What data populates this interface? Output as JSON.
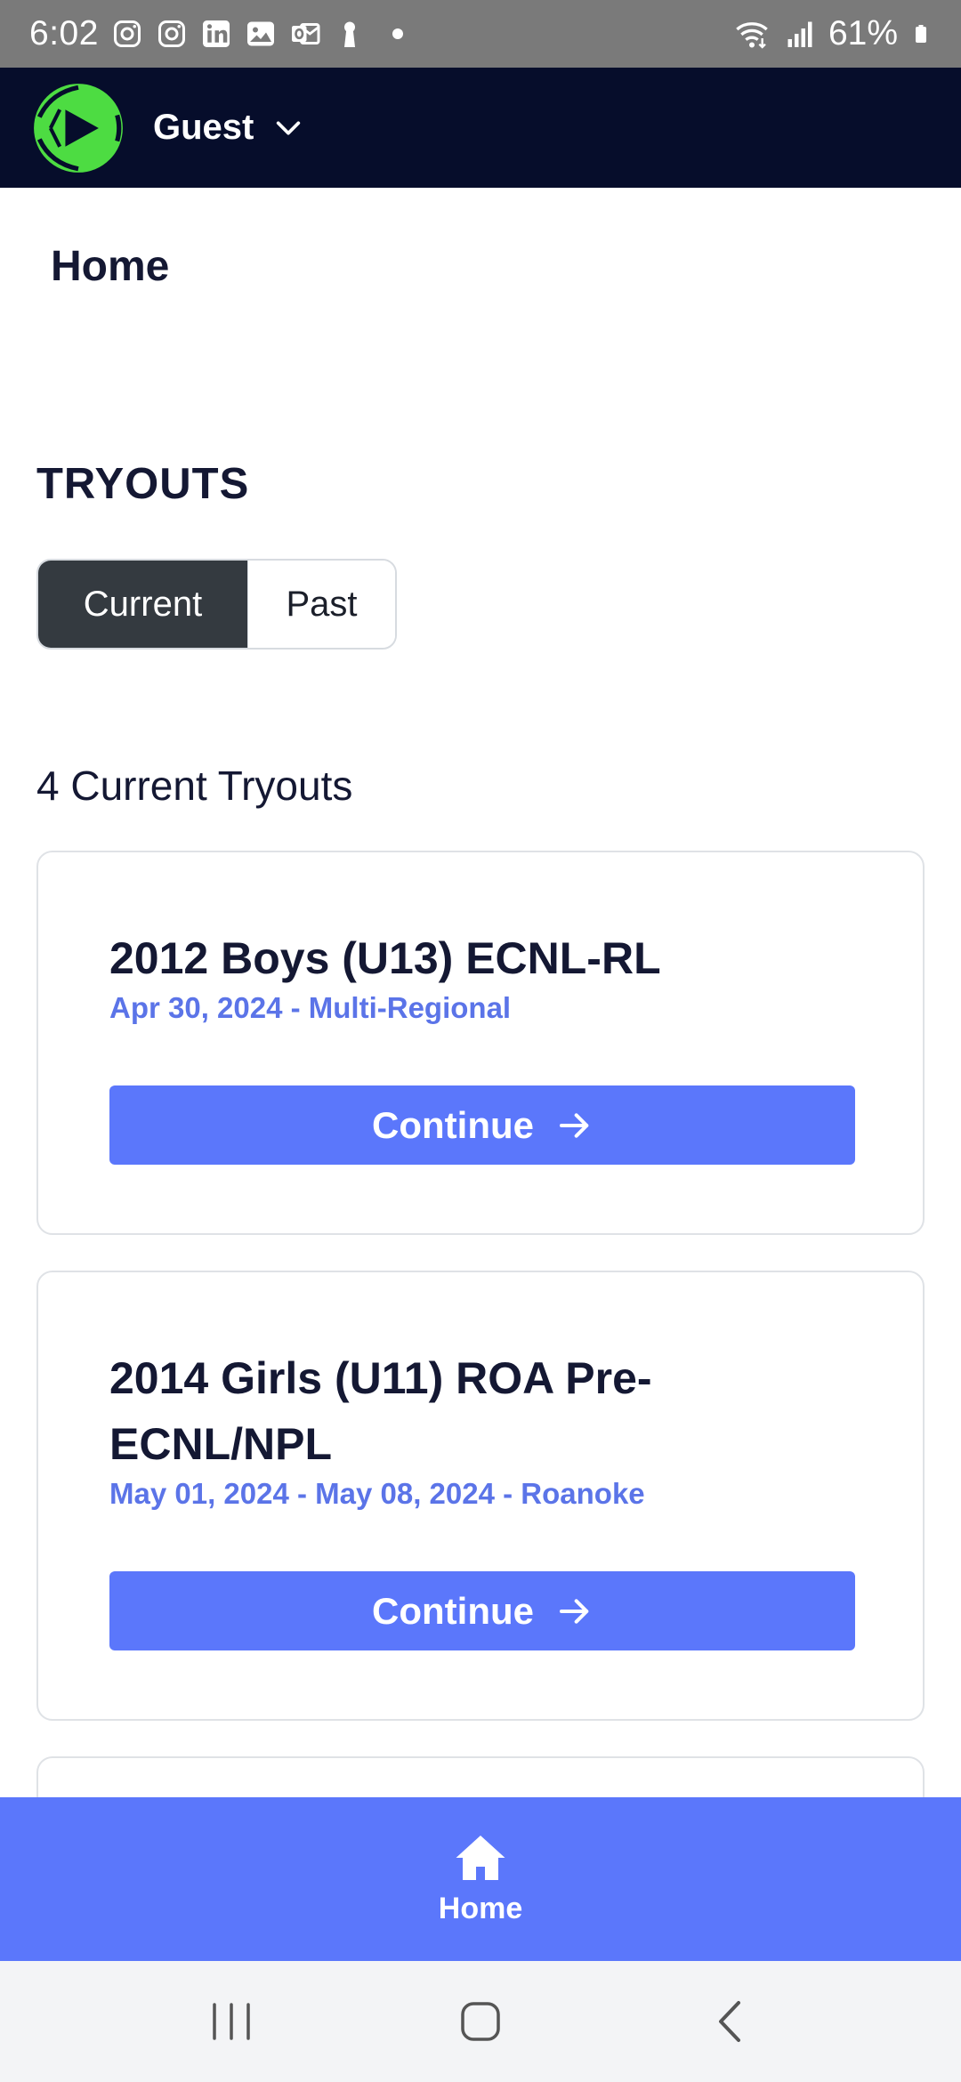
{
  "status_bar": {
    "time": "6:02",
    "battery": "61%",
    "notification_icons": [
      "instagram-icon",
      "instagram-icon",
      "linkedin-icon",
      "gallery-icon",
      "outlook-icon",
      "keyhole-icon",
      "dot-icon"
    ]
  },
  "header": {
    "user": "Guest",
    "colors": {
      "background": "#060d2b",
      "logo_green": "#4ddc42"
    }
  },
  "page": {
    "title": "Home",
    "section_title": "TRYOUTS",
    "toggle": {
      "current": "Current",
      "past": "Past",
      "selected": "Current"
    },
    "count_label": "4 Current Tryouts"
  },
  "tryouts": [
    {
      "title": "2012 Boys (U13) ECNL-RL",
      "subtitle": "Apr 30, 2024 - Multi-Regional",
      "button": "Continue"
    },
    {
      "title": "2014 Girls (U11) ROA Pre-ECNL/NPL",
      "subtitle": "May 01, 2024 - May 08, 2024 - Roanoke",
      "button": "Continue"
    }
  ],
  "bottom_nav": {
    "home_label": "Home",
    "accent": "#5b77fb"
  }
}
